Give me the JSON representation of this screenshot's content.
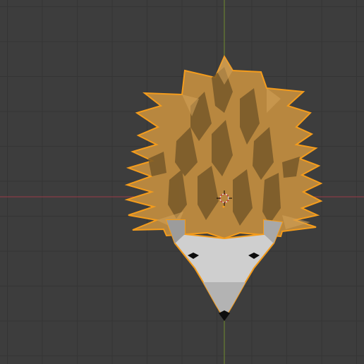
{
  "viewport": {
    "background_color": "#3d3d3d",
    "grid_color": "#353535",
    "x_axis_color": "#9c3a48",
    "y_axis_color": "#6f8a2e"
  },
  "object": {
    "name_icon": "hedgehog-mesh",
    "selected": true,
    "selection_outline_color": "#f49c1c",
    "spines_color": "#b8873f",
    "spines_dark_color": "#6e5226",
    "face_color": "#cfcfcf",
    "face_shadow_color": "#9c9c9c",
    "eyes_nose_color": "#0d0d0d"
  },
  "scene": {
    "origin_marker": "3d-cursor-icon"
  }
}
